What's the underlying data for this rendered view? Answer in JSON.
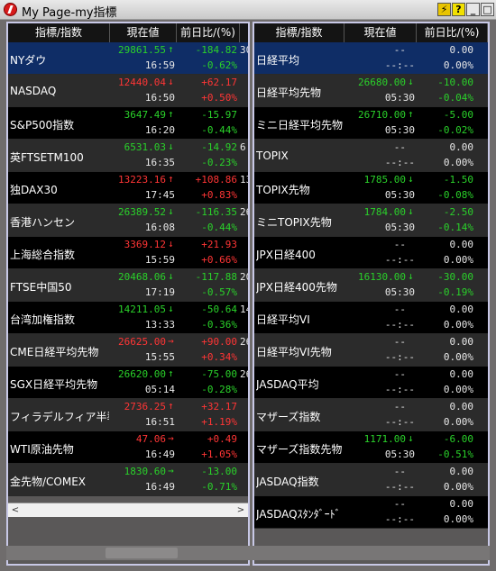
{
  "window": {
    "title": "My Page-my指標",
    "buttons": {
      "lock": "⚡",
      "help": "?",
      "minimize": "_",
      "maximize": "□",
      "close": "×"
    }
  },
  "left_table": {
    "headers": [
      "指標/指数",
      "現在値",
      "前日比/(%)"
    ],
    "rows": [
      {
        "name": "NYダウ",
        "price": "29861.55",
        "arrow": "↑",
        "time": "16:59",
        "change": "-184.82",
        "pct": "-0.62%",
        "price_dir": "dn",
        "change_dir": "dn",
        "extra": "30"
      },
      {
        "name": "NASDAQ",
        "price": "12440.04",
        "arrow": "↓",
        "time": "16:50",
        "change": "+62.17",
        "pct": "+0.50%",
        "price_dir": "up",
        "change_dir": "up",
        "extra": ""
      },
      {
        "name": "S&P500指数",
        "price": "3647.49",
        "arrow": "↑",
        "time": "16:20",
        "change": "-15.97",
        "pct": "-0.44%",
        "price_dir": "dn",
        "change_dir": "dn",
        "extra": ""
      },
      {
        "name": "英FTSETM100",
        "price": "6531.03",
        "arrow": "↓",
        "time": "16:35",
        "change": "-14.92",
        "pct": "-0.23%",
        "price_dir": "dn",
        "change_dir": "dn",
        "extra": "6"
      },
      {
        "name": "独DAX30",
        "price": "13223.16",
        "arrow": "↑",
        "time": "17:45",
        "change": "+108.86",
        "pct": "+0.83%",
        "price_dir": "up",
        "change_dir": "up",
        "extra": "13"
      },
      {
        "name": "香港ハンセン",
        "price": "26389.52",
        "arrow": "↓",
        "time": "16:08",
        "change": "-116.35",
        "pct": "-0.44%",
        "price_dir": "dn",
        "change_dir": "dn",
        "extra": "26"
      },
      {
        "name": "上海総合指数",
        "price": "3369.12",
        "arrow": "↓",
        "time": "15:59",
        "change": "+21.93",
        "pct": "+0.66%",
        "price_dir": "up",
        "change_dir": "up",
        "extra": ""
      },
      {
        "name": "FTSE中国50",
        "price": "20468.06",
        "arrow": "↓",
        "time": "17:19",
        "change": "-117.88",
        "pct": "-0.57%",
        "price_dir": "dn",
        "change_dir": "dn",
        "extra": "20"
      },
      {
        "name": "台湾加権指数",
        "price": "14211.05",
        "arrow": "↓",
        "time": "13:33",
        "change": "-50.64",
        "pct": "-0.36%",
        "price_dir": "dn",
        "change_dir": "dn",
        "extra": "14"
      },
      {
        "name": "CME日経平均先物",
        "price": "26625.00",
        "arrow": "→",
        "time": "15:55",
        "change": "+90.00",
        "pct": "+0.34%",
        "price_dir": "up",
        "change_dir": "up",
        "extra": "26"
      },
      {
        "name": "SGX日経平均先物",
        "price": "26620.00",
        "arrow": "↑",
        "time": "05:14",
        "change": "-75.00",
        "pct": "-0.28%",
        "price_dir": "dn",
        "change_dir": "dn",
        "extra": "26"
      },
      {
        "name": "フィラデルフィア半導",
        "price": "2736.25",
        "arrow": "↑",
        "time": "16:51",
        "change": "+32.17",
        "pct": "+1.19%",
        "price_dir": "up",
        "change_dir": "up",
        "extra": ""
      },
      {
        "name": "WTI原油先物",
        "price": "47.06",
        "arrow": "→",
        "time": "16:49",
        "change": "+0.49",
        "pct": "+1.05%",
        "price_dir": "up",
        "change_dir": "up",
        "extra": ""
      },
      {
        "name": "金先物/COMEX",
        "price": "1830.60",
        "arrow": "→",
        "time": "16:49",
        "change": "-13.00",
        "pct": "-0.71%",
        "price_dir": "dn",
        "change_dir": "dn",
        "extra": ""
      }
    ]
  },
  "right_table": {
    "headers": [
      "指標/指数",
      "現在値",
      "前日比/(%)"
    ],
    "rows": [
      {
        "name": "日経平均",
        "price": "--",
        "arrow": "",
        "time": "--:--",
        "change": "0.00",
        "pct": "0.00%",
        "price_dir": "nt",
        "change_dir": "nt"
      },
      {
        "name": "日経平均先物",
        "price": "26680.00",
        "arrow": "↓",
        "time": "05:30",
        "change": "-10.00",
        "pct": "-0.04%",
        "price_dir": "dn",
        "change_dir": "dn"
      },
      {
        "name": "ミニ日経平均先物",
        "price": "26710.00",
        "arrow": "↑",
        "time": "05:30",
        "change": "-5.00",
        "pct": "-0.02%",
        "price_dir": "dn",
        "change_dir": "dn"
      },
      {
        "name": "TOPIX",
        "price": "--",
        "arrow": "",
        "time": "--:--",
        "change": "0.00",
        "pct": "0.00%",
        "price_dir": "nt",
        "change_dir": "nt"
      },
      {
        "name": "TOPIX先物",
        "price": "1785.00",
        "arrow": "↓",
        "time": "05:30",
        "change": "-1.50",
        "pct": "-0.08%",
        "price_dir": "dn",
        "change_dir": "dn"
      },
      {
        "name": "ミニTOPIX先物",
        "price": "1784.00",
        "arrow": "↓",
        "time": "05:30",
        "change": "-2.50",
        "pct": "-0.14%",
        "price_dir": "dn",
        "change_dir": "dn"
      },
      {
        "name": "JPX日経400",
        "price": "--",
        "arrow": "",
        "time": "--:--",
        "change": "0.00",
        "pct": "0.00%",
        "price_dir": "nt",
        "change_dir": "nt"
      },
      {
        "name": "JPX日経400先物",
        "price": "16130.00",
        "arrow": "↓",
        "time": "05:30",
        "change": "-30.00",
        "pct": "-0.19%",
        "price_dir": "dn",
        "change_dir": "dn"
      },
      {
        "name": "日経平均VI",
        "price": "--",
        "arrow": "",
        "time": "--:--",
        "change": "0.00",
        "pct": "0.00%",
        "price_dir": "nt",
        "change_dir": "nt"
      },
      {
        "name": "日経平均VI先物",
        "price": "--",
        "arrow": "",
        "time": "--:--",
        "change": "0.00",
        "pct": "0.00%",
        "price_dir": "nt",
        "change_dir": "nt"
      },
      {
        "name": "JASDAQ平均",
        "price": "--",
        "arrow": "",
        "time": "--:--",
        "change": "0.00",
        "pct": "0.00%",
        "price_dir": "nt",
        "change_dir": "nt"
      },
      {
        "name": "マザーズ指数",
        "price": "--",
        "arrow": "",
        "time": "--:--",
        "change": "0.00",
        "pct": "0.00%",
        "price_dir": "nt",
        "change_dir": "nt"
      },
      {
        "name": "マザーズ指数先物",
        "price": "1171.00",
        "arrow": "↓",
        "time": "05:30",
        "change": "-6.00",
        "pct": "-0.51%",
        "price_dir": "dn",
        "change_dir": "dn"
      },
      {
        "name": "JASDAQ指数",
        "price": "--",
        "arrow": "",
        "time": "--:--",
        "change": "0.00",
        "pct": "0.00%",
        "price_dir": "nt",
        "change_dir": "nt"
      },
      {
        "name": "JASDAQｽﾀﾝﾀﾞｰﾄﾞ",
        "price": "--",
        "arrow": "",
        "time": "--:--",
        "change": "0.00",
        "pct": "0.00%",
        "price_dir": "nt",
        "change_dir": "nt"
      }
    ]
  },
  "scroll": {
    "left_arrow": "<",
    "right_arrow": ">"
  }
}
